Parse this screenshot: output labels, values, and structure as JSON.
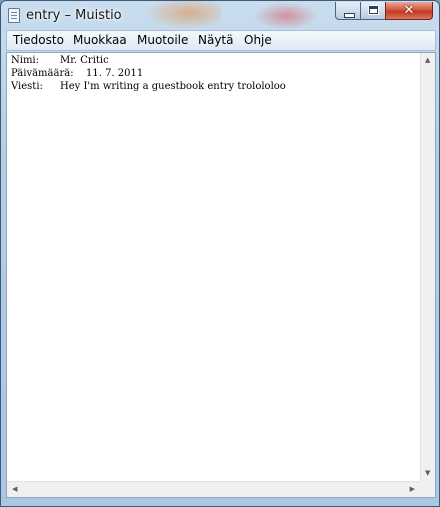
{
  "window": {
    "title": "entry – Muistio",
    "close_glyph": "✕"
  },
  "menu": {
    "items": [
      "Tiedosto",
      "Muokkaa",
      "Muotoile",
      "Näytä",
      "Ohje"
    ]
  },
  "document": {
    "lines": [
      {
        "label": "Nimi:",
        "value": "Mr. Critic"
      },
      {
        "label": "Päivämäärä:",
        "value": "11. 7. 2011"
      },
      {
        "label": "Viesti:",
        "value": "Hey I'm writing a guestbook entry trolololoo"
      }
    ]
  },
  "scroll": {
    "up_arrow": "▲",
    "down_arrow": "▼",
    "left_arrow": "◀",
    "right_arrow": "▶"
  },
  "colors": {
    "close_button": "#c23a22",
    "frame": "#b5cee6"
  }
}
